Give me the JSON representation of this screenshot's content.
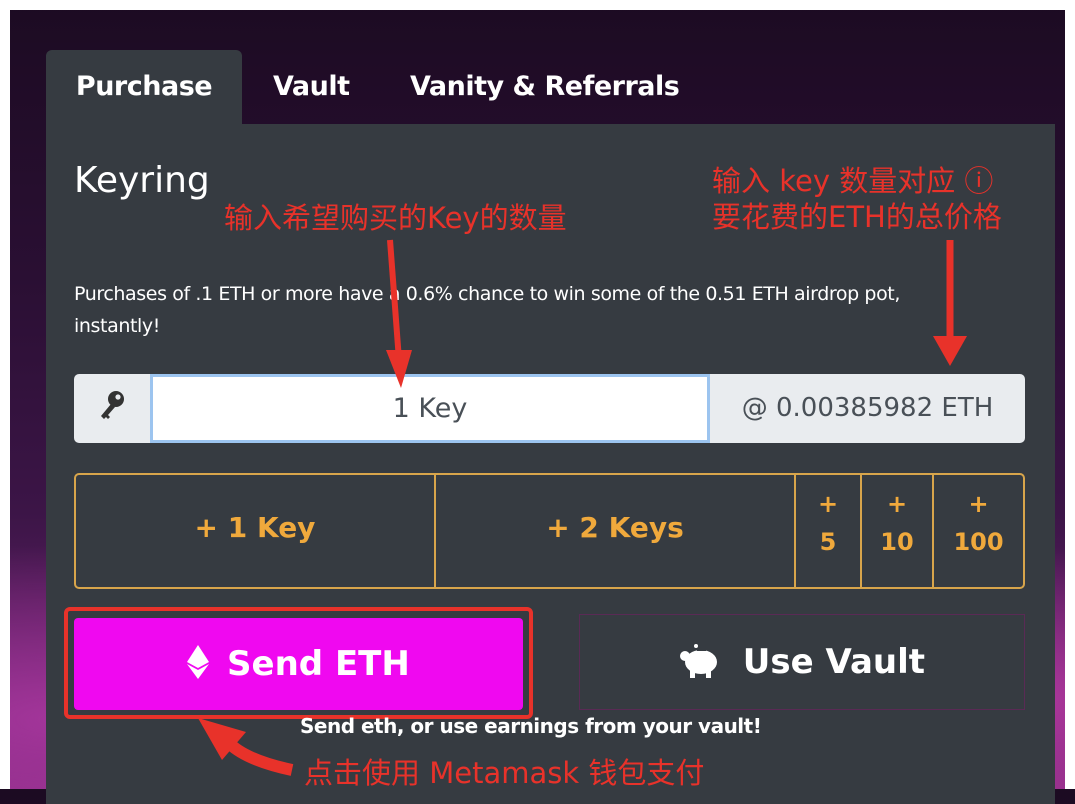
{
  "tabs": [
    {
      "label": "Purchase",
      "active": true
    },
    {
      "label": "Vault",
      "active": false
    },
    {
      "label": "Vanity & Referrals",
      "active": false
    }
  ],
  "section_title": "Keyring",
  "description": "Purchases of .1 ETH or more have a 0.6% chance to win some of the 0.51 ETH airdrop pot, instantly!",
  "key_input": {
    "value": "1 Key",
    "icon": "key-icon"
  },
  "price": "@ 0.00385982 ETH",
  "quick_add": {
    "plus_one": "+ 1 Key",
    "plus_two": "+ 2 Keys",
    "plus_sign": "+",
    "five": "5",
    "ten": "10",
    "hundred": "100"
  },
  "buttons": {
    "send_icon": "ethereum-icon",
    "send_label": "Send ETH",
    "vault_icon": "piggy-bank-icon",
    "vault_label": "Use Vault"
  },
  "hint": "Send eth, or use earnings from your vault!",
  "annotations": {
    "input_note": "输入希望购买的Key的数量",
    "price_note_line1": "输入 key 数量对应 ⓘ",
    "price_note_line2": "要花费的ETH的总价格",
    "send_note": "点击使用 Metamask 钱包支付"
  },
  "colors": {
    "panel": "#363b41",
    "accent_gold": "#f0a93c",
    "send_magenta": "#f008f0",
    "annotation_red": "#e8322a"
  }
}
